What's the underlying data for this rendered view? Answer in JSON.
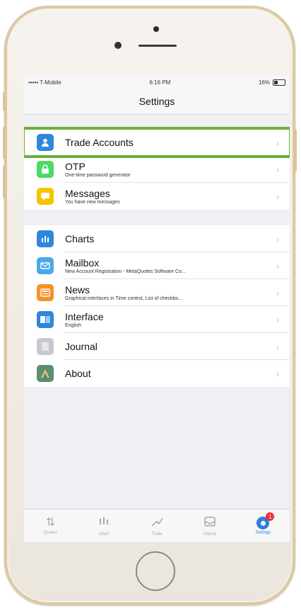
{
  "status_bar": {
    "carrier": "••••• T-Mobile",
    "time": "6:16 PM",
    "battery": "16%"
  },
  "nav": {
    "title": "Settings"
  },
  "groups": [
    {
      "items": [
        {
          "label": "Trade Accounts",
          "subtitle": "",
          "icon": "user-icon",
          "color": "#2f86de",
          "highlighted": true
        }
      ]
    },
    {
      "items": [
        {
          "label": "OTP",
          "subtitle": "One-time password generator",
          "icon": "otp-lock-icon",
          "color": "#4cd964"
        },
        {
          "label": "Messages",
          "subtitle": "You have new messages",
          "icon": "message-icon",
          "color": "#f5c400"
        }
      ]
    },
    {
      "items": [
        {
          "label": "Charts",
          "subtitle": "",
          "icon": "charts-icon",
          "color": "#2f86de"
        },
        {
          "label": "Mailbox",
          "subtitle": "New Account Registration - MetaQuotes Software Co...",
          "icon": "mailbox-icon",
          "color": "#4aa8e8"
        },
        {
          "label": "News",
          "subtitle": "Graphical interfaces in Time control, List of checkbo...",
          "icon": "news-icon",
          "color": "#f5922a"
        },
        {
          "label": "Interface",
          "subtitle": "English",
          "icon": "interface-language-icon",
          "color": "#2f86de"
        },
        {
          "label": "Journal",
          "subtitle": "",
          "icon": "journal-icon",
          "color": "#c8c8d0"
        },
        {
          "label": "About",
          "subtitle": "",
          "icon": "about-icon",
          "color": "#5b8f6e"
        }
      ]
    }
  ],
  "tabs": [
    {
      "label": "Quotes",
      "icon": "quotes-icon"
    },
    {
      "label": "Chart",
      "icon": "chart-icon"
    },
    {
      "label": "Trade",
      "icon": "trade-icon"
    },
    {
      "label": "History",
      "icon": "history-icon"
    },
    {
      "label": "Settings",
      "icon": "settings-icon",
      "active": true,
      "badge": "1"
    }
  ],
  "colors": {
    "highlight": "#6cae3e",
    "accent": "#2f7de1"
  }
}
